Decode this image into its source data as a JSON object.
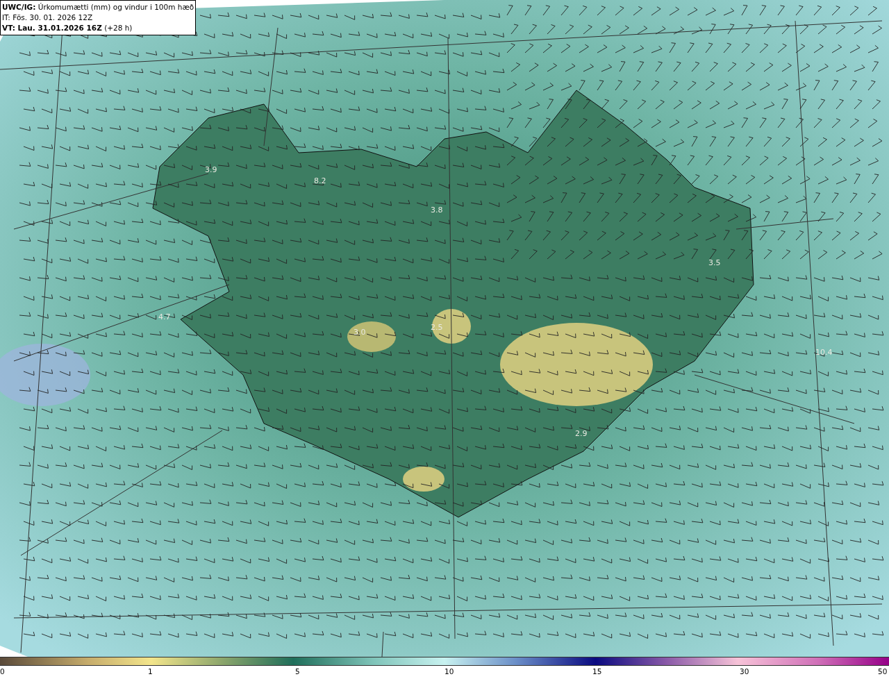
{
  "header": {
    "model": "UWC/IG:",
    "title": "Úrkomumætti (mm) og vindur i 100m hæð",
    "init_time": "IT: Fös. 30. 01. 2026 12Z",
    "valid_label": "VT: Lau. 31.01.2026 16Z",
    "lead": "(+28 h)"
  },
  "map_labels": [
    "3.9",
    "8.2",
    "3.8",
    "3.5",
    "4.7",
    "3.0",
    "2.5",
    "10.4",
    "2.9"
  ],
  "colorbar": {
    "ticks": [
      "0",
      "1",
      "5",
      "10",
      "15",
      "30",
      "50"
    ]
  }
}
